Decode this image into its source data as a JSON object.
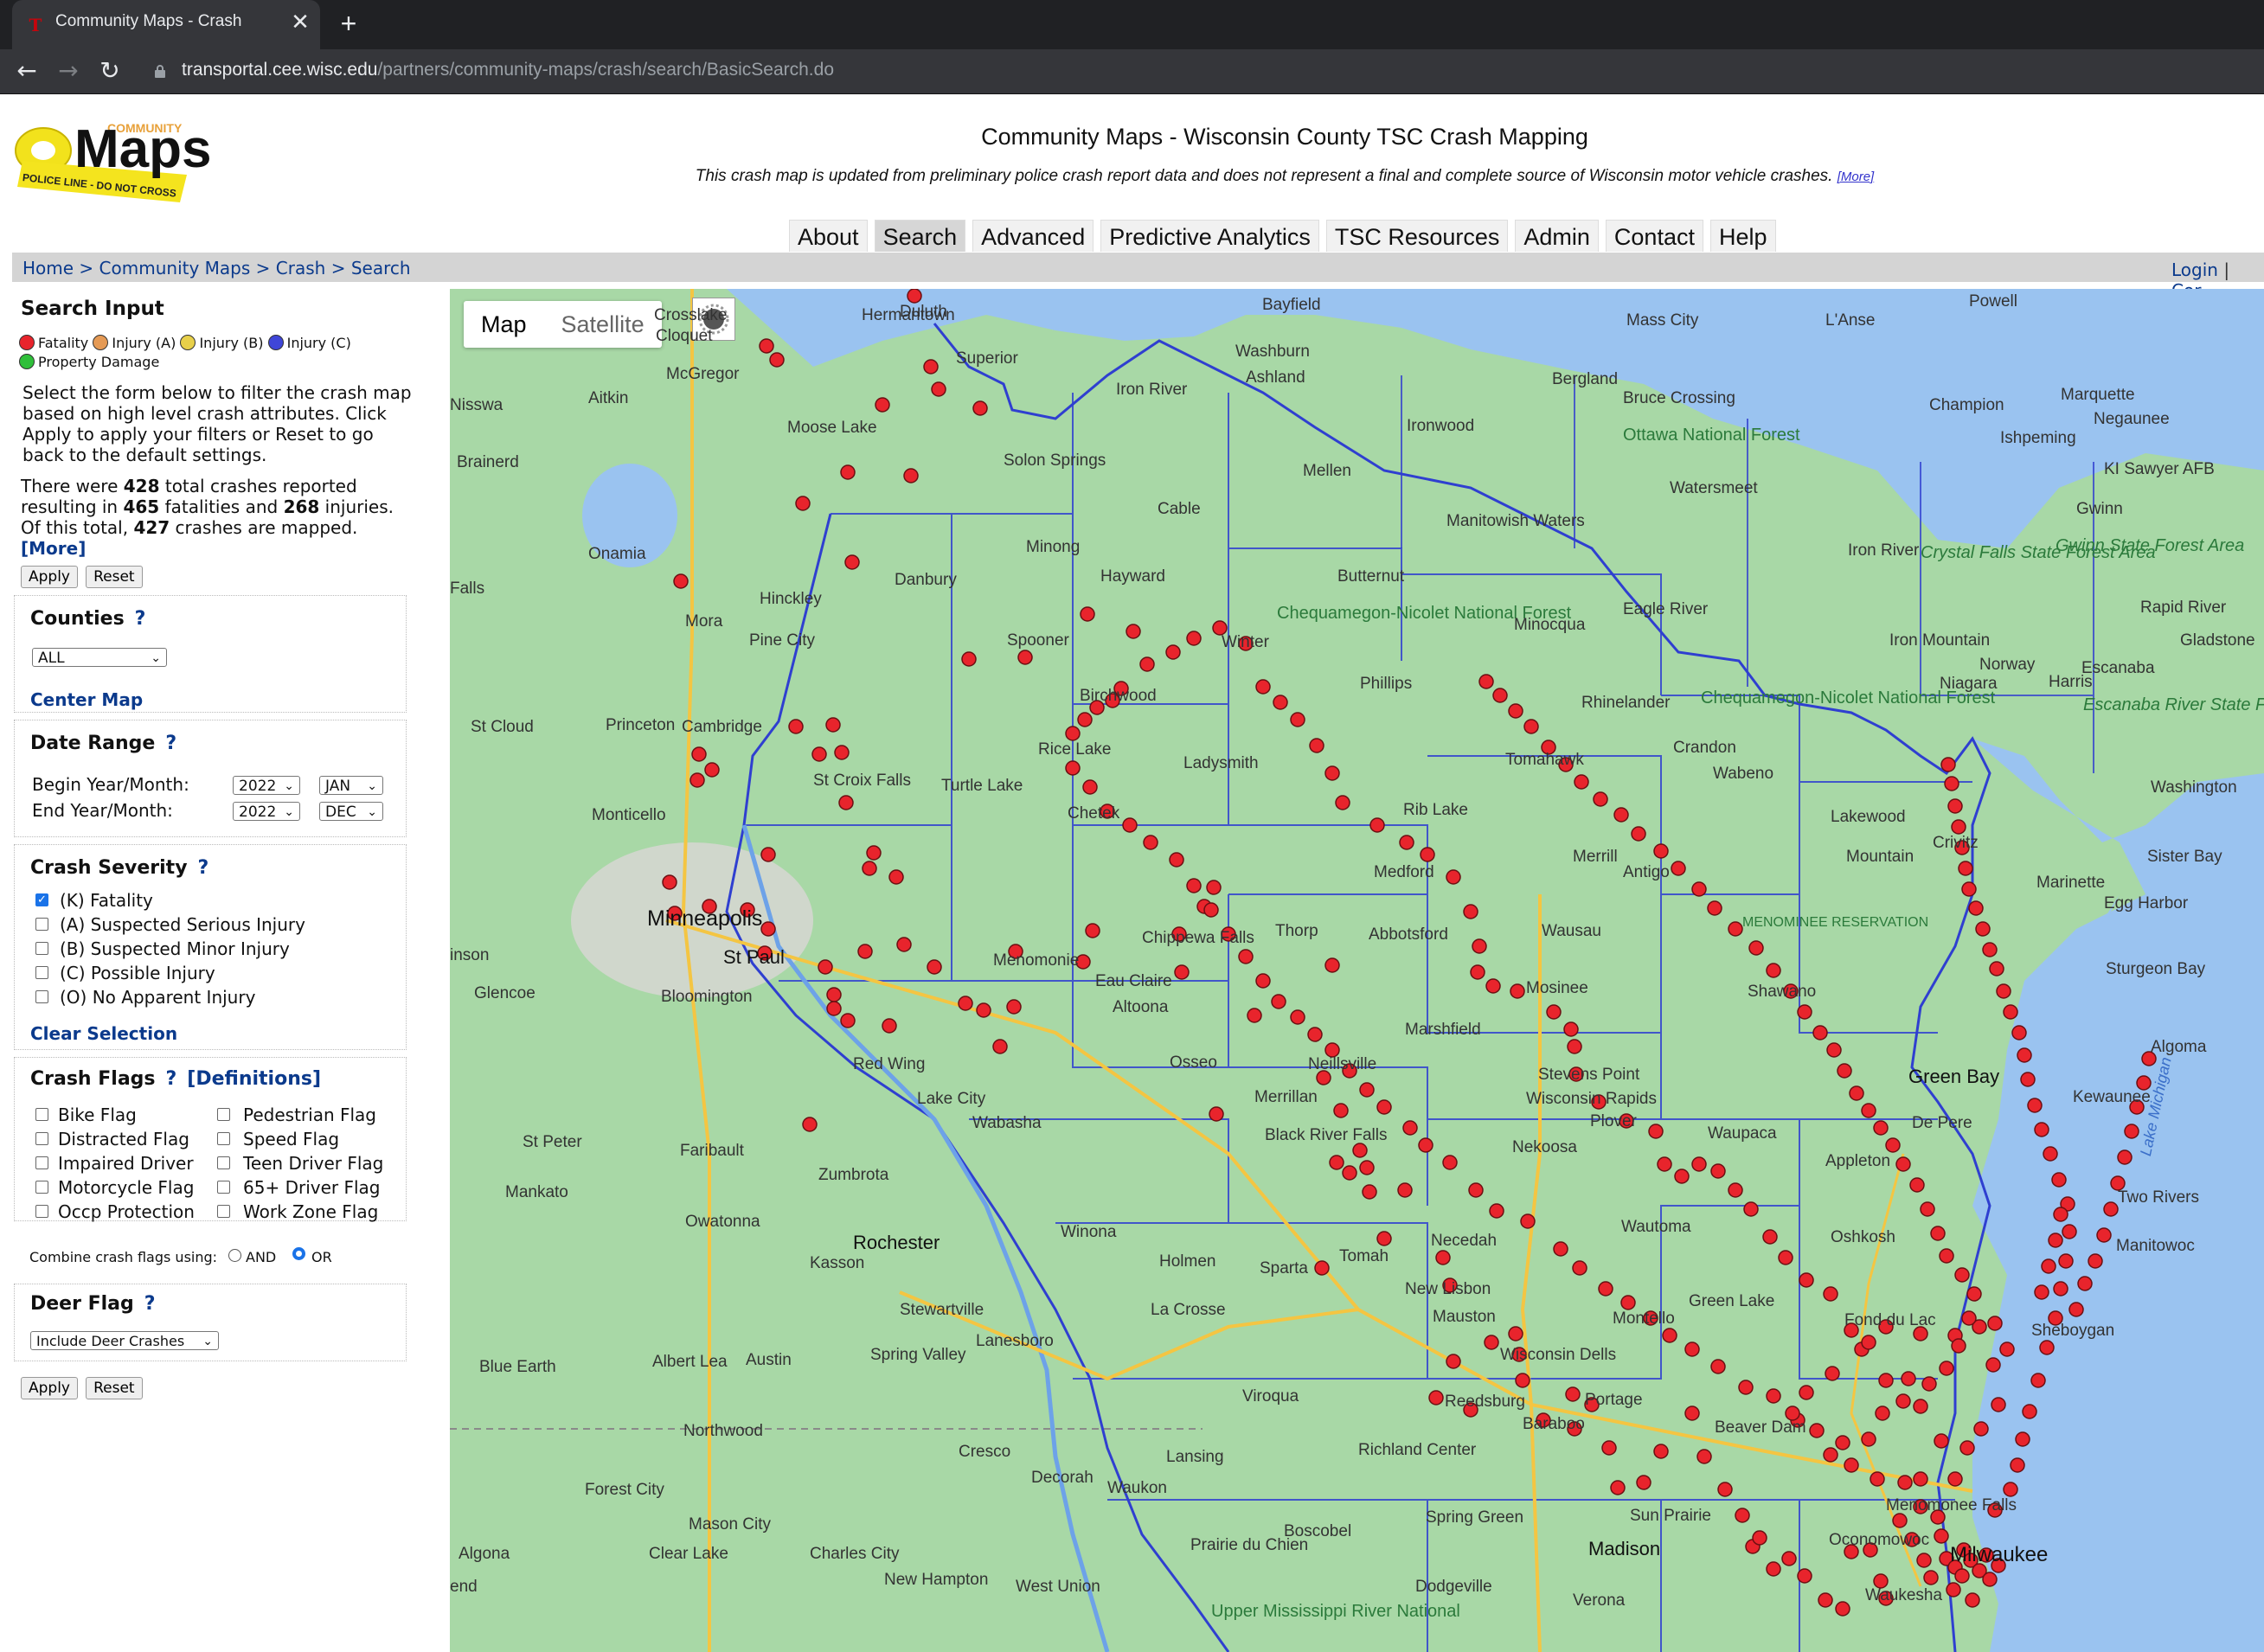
{
  "browser": {
    "tab_title": "Community Maps - Crash",
    "tab_close": "✕",
    "new_tab": "+",
    "url_host": "transportal.cee.wisc.edu",
    "url_path": "/partners/community-maps/crash/search/BasicSearch.do",
    "back_icon": "←",
    "forward_icon": "→",
    "reload_icon": "↻"
  },
  "header": {
    "logo_top": "COMMUNITY",
    "logo_main": "Maps",
    "logo_tape": "POLICE LINE - DO NOT CROSS",
    "title": "Community Maps - Wisconsin County TSC Crash Mapping",
    "disclaimer": "This crash map is updated from preliminary police crash report data and does not represent a final and complete source of Wisconsin motor vehicle crashes.",
    "disclaimer_more": "[More]"
  },
  "nav": {
    "tabs": [
      {
        "label": "About"
      },
      {
        "label": "Search",
        "active": true
      },
      {
        "label": "Advanced"
      },
      {
        "label": "Predictive Analytics"
      },
      {
        "label": "TSC Resources"
      },
      {
        "label": "Admin"
      },
      {
        "label": "Contact"
      },
      {
        "label": "Help"
      }
    ]
  },
  "breadcrumb": {
    "items": [
      "Home",
      "Community Maps",
      "Crash",
      "Search"
    ],
    "separator": ">",
    "login": "Login",
    "login_sep": "|",
    "contact_partial": "Cor"
  },
  "sidebar": {
    "title": "Search Input",
    "legend": [
      {
        "label": "Fatality",
        "color": "#e8242c"
      },
      {
        "label": "Injury (A)",
        "color": "#e59a55"
      },
      {
        "label": "Injury (B)",
        "color": "#e8d04a"
      },
      {
        "label": "Injury (C)",
        "color": "#3f46d8"
      },
      {
        "label": "Property Damage",
        "color": "#2fbf3a"
      }
    ],
    "intro": "Select the form below to filter the crash map based on high level crash attributes. Click Apply to apply your filters or Reset to go back to the default settings.",
    "summary_1": "There were ",
    "total_crashes": "428",
    "summary_2": " total crashes reported resulting in ",
    "fatalities": "465",
    "summary_3": " fatalities and ",
    "injuries": "268",
    "summary_4": " injuries. Of this total, ",
    "mapped": "427",
    "summary_5": " crashes are mapped.",
    "more": "[More]",
    "apply": "Apply",
    "reset": "Reset",
    "counties": {
      "title": "Counties",
      "help": "?",
      "value": "ALL",
      "center_map": "Center Map"
    },
    "date_range": {
      "title": "Date Range",
      "help": "?",
      "begin_label": "Begin Year/Month:",
      "begin_year": "2022",
      "begin_month": "JAN",
      "end_label": "End Year/Month:",
      "end_year": "2022",
      "end_month": "DEC"
    },
    "severity": {
      "title": "Crash Severity",
      "help": "?",
      "options": [
        {
          "label": "(K) Fatality",
          "checked": true
        },
        {
          "label": "(A) Suspected Serious Injury",
          "checked": false
        },
        {
          "label": "(B) Suspected Minor Injury",
          "checked": false
        },
        {
          "label": "(C) Possible Injury",
          "checked": false
        },
        {
          "label": "(O) No Apparent Injury",
          "checked": false
        }
      ],
      "clear": "Clear Selection"
    },
    "flags": {
      "title": "Crash Flags",
      "help": "?",
      "definitions": "[Definitions]",
      "left": [
        "Bike Flag",
        "Distracted Flag",
        "Impaired Driver",
        "Motorcycle Flag",
        "Occp Protection"
      ],
      "right": [
        "Pedestrian Flag",
        "Speed Flag",
        "Teen Driver Flag",
        "65+ Driver Flag",
        "Work Zone Flag"
      ],
      "combine_label": "Combine crash flags using:",
      "and": "AND",
      "or": "OR",
      "selected": "OR"
    },
    "deer": {
      "title": "Deer Flag",
      "help": "?",
      "value": "Include Deer Crashes"
    }
  },
  "map": {
    "type_map": "Map",
    "type_satellite": "Satellite",
    "active_type": "Map",
    "places": {
      "minneapolis": "Minneapolis",
      "st_paul": "St Paul",
      "rochester": "Rochester",
      "madison": "Madison",
      "milwaukee": "Milwaukee",
      "duluth": "Duluth",
      "hermantown": "Hermantown",
      "cloquet": "Cloquet",
      "superior": "Superior",
      "bayfield": "Bayfield",
      "washburn": "Washburn",
      "ashland": "Ashland",
      "iron_river": "Iron River",
      "ironwood": "Ironwood",
      "bergland": "Bergland",
      "bruce_crossing": "Bruce Crossing",
      "mass_city": "Mass City",
      "lanse": "L'Anse",
      "powell": "Powell",
      "marquette": "Marquette",
      "champion": "Champion",
      "negaunee": "Negaunee",
      "ishpeming": "Ishpeming",
      "ki_sawyer": "KI Sawyer AFB",
      "gwinn": "Gwinn",
      "moose_lake": "Moose Lake",
      "mcgregor": "McGregor",
      "solon_springs": "Solon Springs",
      "cable": "Cable",
      "mellen": "Mellen",
      "ottawa": "Ottawa National Forest",
      "watersmeet": "Watersmeet",
      "iron_river_mi": "Iron River",
      "crystal_falls": "Crystal Falls State Forest Area",
      "gwinn_forest": "Gwinn State Forest Area",
      "manitowish": "Manitowish Waters",
      "minong": "Minong",
      "hayward": "Hayward",
      "butternut": "Butternut",
      "danbury": "Danbury",
      "hinckley": "Hinckley",
      "pine_city": "Pine City",
      "mora": "Mora",
      "spooner": "Spooner",
      "winter": "Winter",
      "chequamegon": "Chequamegon-Nicolet National Forest",
      "minocqua": "Minocqua",
      "eagle_river": "Eagle River",
      "iron_mountain": "Iron Mountain",
      "norway": "Norway",
      "escanaba": "Escanaba",
      "gladstone": "Gladstone",
      "rapid_river": "Rapid River",
      "harris": "Harris",
      "birchwood": "Birchwood",
      "phillips": "Phillips",
      "rhinelander": "Rhinelander",
      "chequamegon2": "Chequamegon-Nicolet National Forest",
      "niagara": "Niagara",
      "escanaba_forest": "Escanaba River State Forest",
      "washington": "Washington",
      "rice_lake": "Rice Lake",
      "ladysmith": "Ladysmith",
      "tomahawk": "Tomahawk",
      "crandon": "Crandon",
      "wabeno": "Wabeno",
      "st_croix_falls": "St Croix Falls",
      "turtle_lake": "Turtle Lake",
      "chetek": "Chetek",
      "rib_lake": "Rib Lake",
      "lakewood": "Lakewood",
      "crivitz": "Crivitz",
      "sister_bay": "Sister Bay",
      "monticello": "Monticello",
      "st_cloud": "St Cloud",
      "princeton": "Princeton",
      "cambridge": "Cambridge",
      "merrill": "Merrill",
      "antigo": "Antigo",
      "mountain": "Mountain",
      "medford": "Medford",
      "marinette": "Marinette",
      "egg_harbor": "Egg Harbor",
      "menominee": "MENOMINEE RESERVATION",
      "thorp": "Thorp",
      "abbotsford": "Abbotsford",
      "wausau": "Wausau",
      "menomonie": "Menomonie",
      "chippewa_falls": "Chippewa Falls",
      "sturgeon_bay": "Sturgeon Bay",
      "eau_claire": "Eau Claire",
      "altoona": "Altoona",
      "mosinee": "Mosinee",
      "shawano": "Shawano",
      "glencoe": "Glencoe",
      "bloomington": "Bloomington",
      "marshfield": "Marshfield",
      "algoma": "Algoma",
      "red_wing": "Red Wing",
      "osseo": "Osseo",
      "neillsville": "Neillsville",
      "stevens_point": "Stevens Point",
      "green_bay": "Green Bay",
      "lake_city": "Lake City",
      "wabasha": "Wabasha",
      "merrillan": "Merrillan",
      "wisconsin_rapids": "Wisconsin Rapids",
      "plover": "Plover",
      "waupaca": "Waupaca",
      "de_pere": "De Pere",
      "kewaunee": "Kewaunee",
      "st_peter": "St Peter",
      "faribault": "Faribault",
      "black_river_falls": "Black River Falls",
      "nekoosa": "Nekoosa",
      "appleton": "Appleton",
      "mankato": "Mankato",
      "zumbrota": "Zumbrota",
      "two_rivers": "Two Rivers",
      "owatonna": "Owatonna",
      "winona": "Winona",
      "wautoma": "Wautoma",
      "oshkosh": "Oshkosh",
      "manitowoc": "Manitowoc",
      "kasson": "Kasson",
      "holmen": "Holmen",
      "sparta": "Sparta",
      "tomah": "Tomah",
      "necedah": "Necedah",
      "new_lisbon": "New Lisbon",
      "la_crosse": "La Crosse",
      "stewartville": "Stewartville",
      "mauston": "Mauston",
      "montello": "Montello",
      "green_lake": "Green Lake",
      "fond_du_lac": "Fond du Lac",
      "sheboygan": "Sheboygan",
      "lanesboro": "Lanesboro",
      "spring_valley": "Spring Valley",
      "blue_earth": "Blue Earth",
      "albert_lea": "Albert Lea",
      "austin": "Austin",
      "wisconsin_dells": "Wisconsin Dells",
      "viroqua": "Viroqua",
      "reedsburg": "Reedsburg",
      "baraboo": "Baraboo",
      "portage": "Portage",
      "beaver_dam": "Beaver Dam",
      "northwood": "Northwood",
      "cresco": "Cresco",
      "richland_center": "Richland Center",
      "lansing": "Lansing",
      "forest_city": "Forest City",
      "decorah": "Decorah",
      "waukon": "Waukon",
      "sun_prairie": "Sun Prairie",
      "mason_city": "Mason City",
      "spring_green": "Spring Green",
      "menomonee_falls": "Menomonee Falls",
      "oconomowoc": "Oconomowoc",
      "algona": "Algona",
      "clear_lake": "Clear Lake",
      "charles_city": "Charles City",
      "boscobel": "Boscobel",
      "prairie_du_chien": "Prairie du Chien",
      "new_hampton": "New Hampton",
      "west_union": "West Union",
      "dodgeville": "Dodgeville",
      "verona": "Verona",
      "waukesha": "Waukesha",
      "upper_miss": "Upper Mississippi River National",
      "lake_michigan": "Lake Michigan",
      "aitkin": "Aitkin",
      "onamia": "Onamia",
      "brainerd": "Brainerd",
      "crosslake": "Crosslake",
      "nisswa": "Nisswa",
      "falls": "Falls",
      "hutchinson": "inson",
      "end": "end"
    }
  }
}
